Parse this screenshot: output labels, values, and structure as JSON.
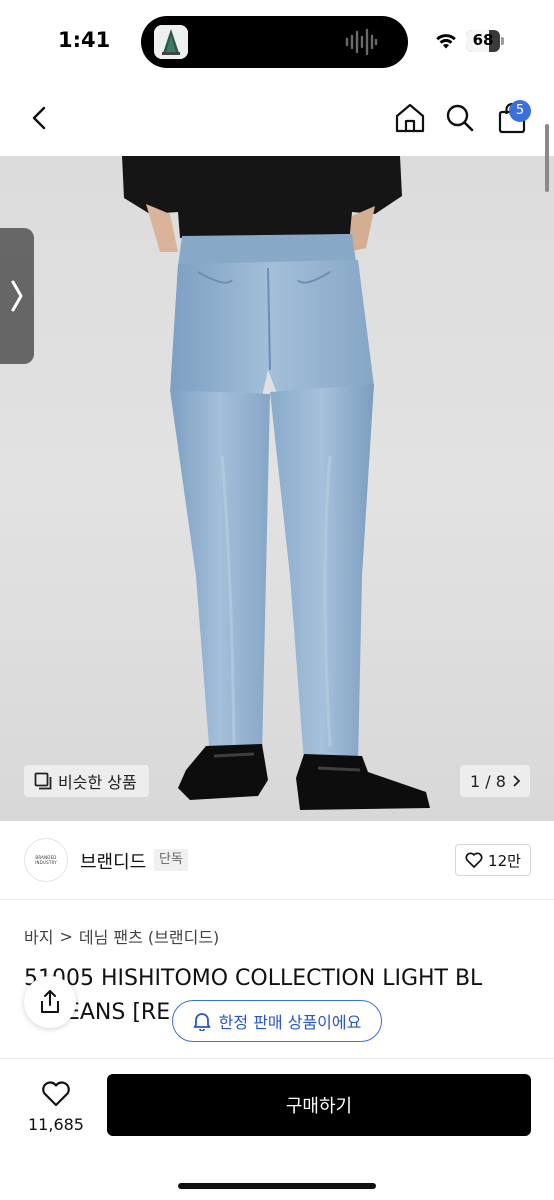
{
  "status_bar": {
    "time": "1:41",
    "battery_level": "68",
    "icons": [
      "now-playing-art-icon",
      "audio-wave-icon",
      "wifi-icon",
      "battery-icon"
    ]
  },
  "nav": {
    "back_icon": "chevron-left-icon",
    "home_icon": "home-icon",
    "search_icon": "search-icon",
    "cart_icon": "shopping-bag-icon",
    "cart_badge": "5"
  },
  "gallery": {
    "similar_label": "비슷한 상품",
    "counter": "1 / 8",
    "side_tab_icon": "chevron-right-icon"
  },
  "brand": {
    "logo_text": "BRANDED INDUSTRY",
    "name": "브랜디드",
    "tag": "단독",
    "likes": "12만"
  },
  "breadcrumb": {
    "level1": "바지",
    "separator": ">",
    "level2": "데님 팬츠 (브랜디드)"
  },
  "product": {
    "title": "51005 HISHITOMO COLLECTION LIGHT BL\n      EANS [RE"
  },
  "toast": {
    "label": "한정 판매 상품이에요"
  },
  "bottom": {
    "wish_count": "11,685",
    "buy_label": "구매하기"
  },
  "colors": {
    "accent_blue": "#3b6fe0",
    "buy_button": "#000000",
    "photo_background": "#dddddd",
    "denim": "#8fb0d0"
  }
}
